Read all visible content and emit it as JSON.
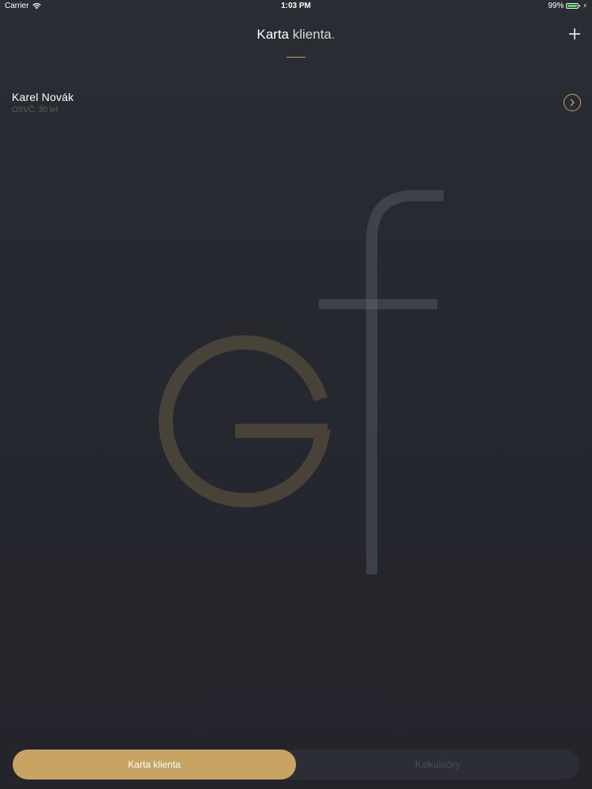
{
  "status_bar": {
    "carrier": "Carrier",
    "time": "1:03 PM",
    "battery": "99%",
    "battery_level": 0.99,
    "wifi_icon": "wifi-icon",
    "charge_icon": "charging-bolt-icon"
  },
  "header": {
    "title_strong": "Karta",
    "title_light": "klienta",
    "title_dot": ".",
    "add_icon": "plus-icon"
  },
  "client": {
    "name": "Karel Novák",
    "subtitle": "OSVČ, 30 let",
    "chevron_icon": "chevron-right-circle-icon"
  },
  "watermark": {
    "logo_icon": "gf-logo-watermark",
    "accent_color": "#c7a462"
  },
  "tabs": [
    {
      "label": "Karta klienta",
      "active": true
    },
    {
      "label": "Kalkulačky",
      "active": false
    }
  ],
  "colors": {
    "accent": "#c7a462",
    "background": "#25282e",
    "battery": "#4cd964"
  }
}
